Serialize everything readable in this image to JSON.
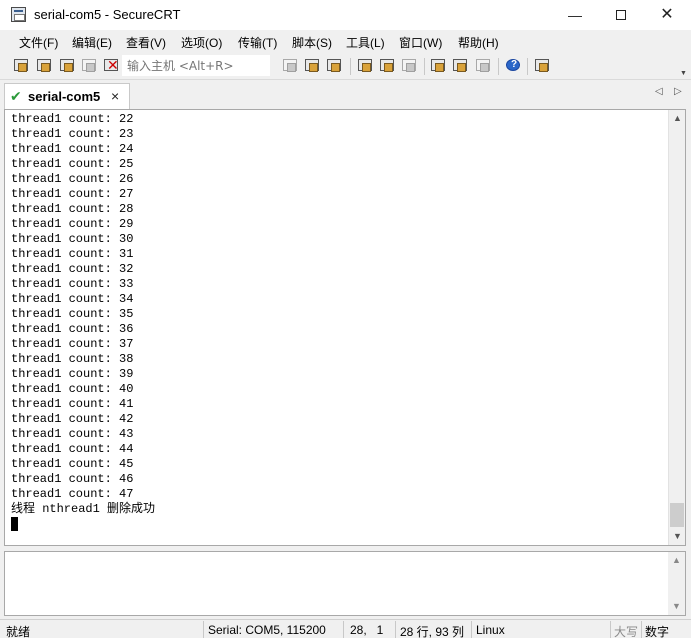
{
  "window": {
    "title": "serial-com5 - SecureCRT",
    "controls": {
      "minimize": "—",
      "close": "✕"
    }
  },
  "menu": [
    "文件(F)",
    "编辑(E)",
    "查看(V)",
    "选项(O)",
    "传输(T)",
    "脚本(S)",
    "工具(L)",
    "窗口(W)",
    "帮助(H)"
  ],
  "toolbar": {
    "quick_connect_placeholder": "输入主机 <Alt+R>",
    "icons": [
      "connect-icon",
      "quick-connect-icon",
      "connect-in-tab-icon",
      "reconnect-icon",
      "disconnect-icon",
      "copy-icon",
      "paste-icon",
      "find-icon",
      "print-icon",
      "print-selection-icon",
      "print-setup-icon",
      "session-options-icon",
      "global-options-icon",
      "keymap-icon",
      "help-icon",
      "sftp-icon"
    ]
  },
  "tabs": [
    {
      "label": "serial-com5",
      "close": "×",
      "active": true
    }
  ],
  "tab_nav": {
    "prev": "◁",
    "next": "▷"
  },
  "terminal": {
    "lines": [
      "thread1 count: 22",
      "thread1 count: 23",
      "thread1 count: 24",
      "thread1 count: 25",
      "thread1 count: 26",
      "thread1 count: 27",
      "thread1 count: 28",
      "thread1 count: 29",
      "thread1 count: 30",
      "thread1 count: 31",
      "thread1 count: 32",
      "thread1 count: 33",
      "thread1 count: 34",
      "thread1 count: 35",
      "thread1 count: 36",
      "thread1 count: 37",
      "thread1 count: 38",
      "thread1 count: 39",
      "thread1 count: 40",
      "thread1 count: 41",
      "thread1 count: 42",
      "thread1 count: 43",
      "thread1 count: 44",
      "thread1 count: 45",
      "thread1 count: 46",
      "thread1 count: 47",
      "线程 nthread1 删除成功"
    ],
    "scroll_position": 0.95
  },
  "status": {
    "ready": "就绪",
    "connection": "Serial: COM5, 115200",
    "cursor_pos": "28,   1",
    "dimensions": "28 行, 93 列",
    "terminal_type": "Linux",
    "caps": "大写",
    "num": "数字"
  },
  "colors": {
    "check": "#2b9a3a",
    "terminal_bg": "#ffffff",
    "chrome_bg": "#f0f0f0"
  }
}
